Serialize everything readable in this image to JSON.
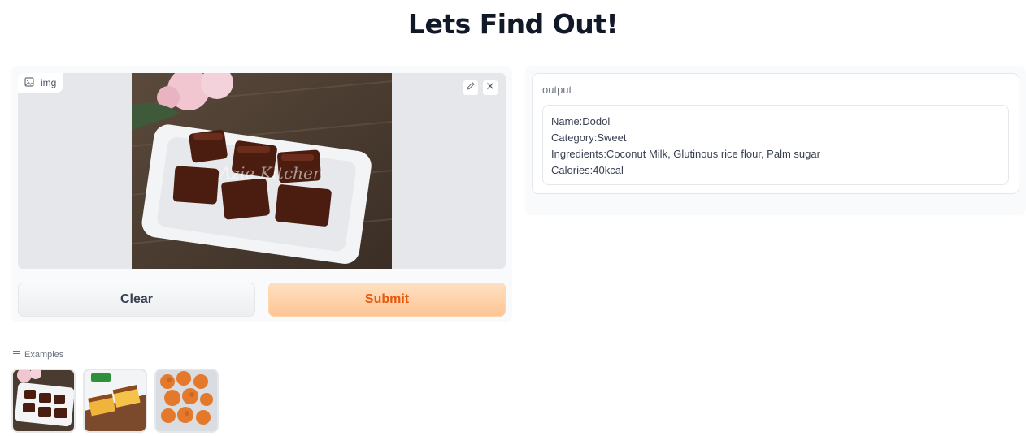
{
  "header": {
    "title": "Lets Find Out!"
  },
  "input_panel": {
    "image_label": "img",
    "watermark": "Azie Kitchen",
    "buttons": {
      "clear": "Clear",
      "submit": "Submit"
    }
  },
  "output_panel": {
    "label": "output",
    "lines": [
      "Name:Dodol",
      "Category:Sweet",
      "Ingredients:Coconut Milk, Glutinous rice flour, Palm sugar",
      "Calories:40kcal"
    ]
  },
  "examples": {
    "label": "Examples",
    "items": [
      "dodol-example",
      "kuih-example",
      "cucur-example"
    ]
  },
  "colors": {
    "accent": "#ea580c",
    "submit_bg": "#fdc594"
  }
}
